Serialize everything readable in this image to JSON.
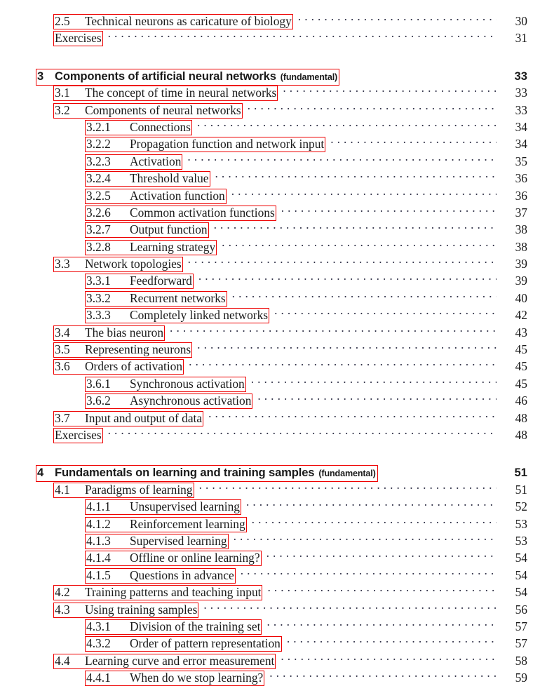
{
  "document": {
    "kind": "table-of-contents",
    "page_background": "#ffffff",
    "text_color": "#1a1a1a",
    "highlight_box_color": "#ee0000",
    "leader_char": "."
  },
  "entries": [
    {
      "level": "section",
      "number": "2.5",
      "title": "Technical neurons as caricature of biology",
      "page": "30",
      "spacer": "none"
    },
    {
      "level": "section",
      "number": "",
      "title": "Exercises",
      "page": "31",
      "spacer": "none"
    },
    {
      "level": "chapter",
      "number": "3",
      "title": "Components of artificial neural networks",
      "tag": "(fundamental)",
      "page": "33",
      "spacer": "big"
    },
    {
      "level": "section",
      "number": "3.1",
      "title": "The concept of time in neural networks",
      "page": "33",
      "spacer": "none"
    },
    {
      "level": "section",
      "number": "3.2",
      "title": "Components of neural networks",
      "page": "33",
      "spacer": "none"
    },
    {
      "level": "sub",
      "number": "3.2.1",
      "title": "Connections",
      "page": "34",
      "spacer": "none"
    },
    {
      "level": "sub",
      "number": "3.2.2",
      "title": "Propagation function and network input",
      "page": "34",
      "spacer": "none"
    },
    {
      "level": "sub",
      "number": "3.2.3",
      "title": "Activation",
      "page": "35",
      "spacer": "none"
    },
    {
      "level": "sub",
      "number": "3.2.4",
      "title": "Threshold value",
      "page": "36",
      "spacer": "none"
    },
    {
      "level": "sub",
      "number": "3.2.5",
      "title": "Activation function",
      "page": "36",
      "spacer": "none"
    },
    {
      "level": "sub",
      "number": "3.2.6",
      "title": "Common activation functions",
      "page": "37",
      "spacer": "none"
    },
    {
      "level": "sub",
      "number": "3.2.7",
      "title": "Output function",
      "page": "38",
      "spacer": "none"
    },
    {
      "level": "sub",
      "number": "3.2.8",
      "title": "Learning strategy",
      "page": "38",
      "spacer": "none"
    },
    {
      "level": "section",
      "number": "3.3",
      "title": "Network topologies",
      "page": "39",
      "spacer": "none"
    },
    {
      "level": "sub",
      "number": "3.3.1",
      "title": "Feedforward",
      "page": "39",
      "spacer": "none"
    },
    {
      "level": "sub",
      "number": "3.3.2",
      "title": "Recurrent networks",
      "page": "40",
      "spacer": "none"
    },
    {
      "level": "sub",
      "number": "3.3.3",
      "title": "Completely linked networks",
      "page": "42",
      "spacer": "none"
    },
    {
      "level": "section",
      "number": "3.4",
      "title": "The bias neuron",
      "page": "43",
      "spacer": "none"
    },
    {
      "level": "section",
      "number": "3.5",
      "title": "Representing neurons",
      "page": "45",
      "spacer": "none"
    },
    {
      "level": "section",
      "number": "3.6",
      "title": "Orders of activation",
      "page": "45",
      "spacer": "none"
    },
    {
      "level": "sub",
      "number": "3.6.1",
      "title": "Synchronous activation",
      "page": "45",
      "spacer": "none"
    },
    {
      "level": "sub",
      "number": "3.6.2",
      "title": "Asynchronous activation",
      "page": "46",
      "spacer": "none"
    },
    {
      "level": "section",
      "number": "3.7",
      "title": "Input and output of data",
      "page": "48",
      "spacer": "none"
    },
    {
      "level": "section",
      "number": "",
      "title": "Exercises",
      "page": "48",
      "spacer": "none"
    },
    {
      "level": "chapter",
      "number": "4",
      "title": "Fundamentals on learning and training samples",
      "tag": "(fundamental)",
      "page": "51",
      "spacer": "big"
    },
    {
      "level": "section",
      "number": "4.1",
      "title": "Paradigms of learning",
      "page": "51",
      "spacer": "none"
    },
    {
      "level": "sub",
      "number": "4.1.1",
      "title": "Unsupervised learning",
      "page": "52",
      "spacer": "none"
    },
    {
      "level": "sub",
      "number": "4.1.2",
      "title": "Reinforcement learning",
      "page": "53",
      "spacer": "none"
    },
    {
      "level": "sub",
      "number": "4.1.3",
      "title": "Supervised learning",
      "page": "53",
      "spacer": "none"
    },
    {
      "level": "sub",
      "number": "4.1.4",
      "title": "Offline or online learning?",
      "page": "54",
      "spacer": "none"
    },
    {
      "level": "sub",
      "number": "4.1.5",
      "title": "Questions in advance",
      "page": "54",
      "spacer": "none"
    },
    {
      "level": "section",
      "number": "4.2",
      "title": "Training patterns and teaching input",
      "page": "54",
      "spacer": "none"
    },
    {
      "level": "section",
      "number": "4.3",
      "title": "Using training samples",
      "page": "56",
      "spacer": "none"
    },
    {
      "level": "sub",
      "number": "4.3.1",
      "title": "Division of the training set",
      "page": "57",
      "spacer": "none"
    },
    {
      "level": "sub",
      "number": "4.3.2",
      "title": "Order of pattern representation",
      "page": "57",
      "spacer": "none"
    },
    {
      "level": "section",
      "number": "4.4",
      "title": "Learning curve and error measurement",
      "page": "58",
      "spacer": "none"
    },
    {
      "level": "sub",
      "number": "4.4.1",
      "title": "When do we stop learning?",
      "page": "59",
      "spacer": "none"
    }
  ]
}
